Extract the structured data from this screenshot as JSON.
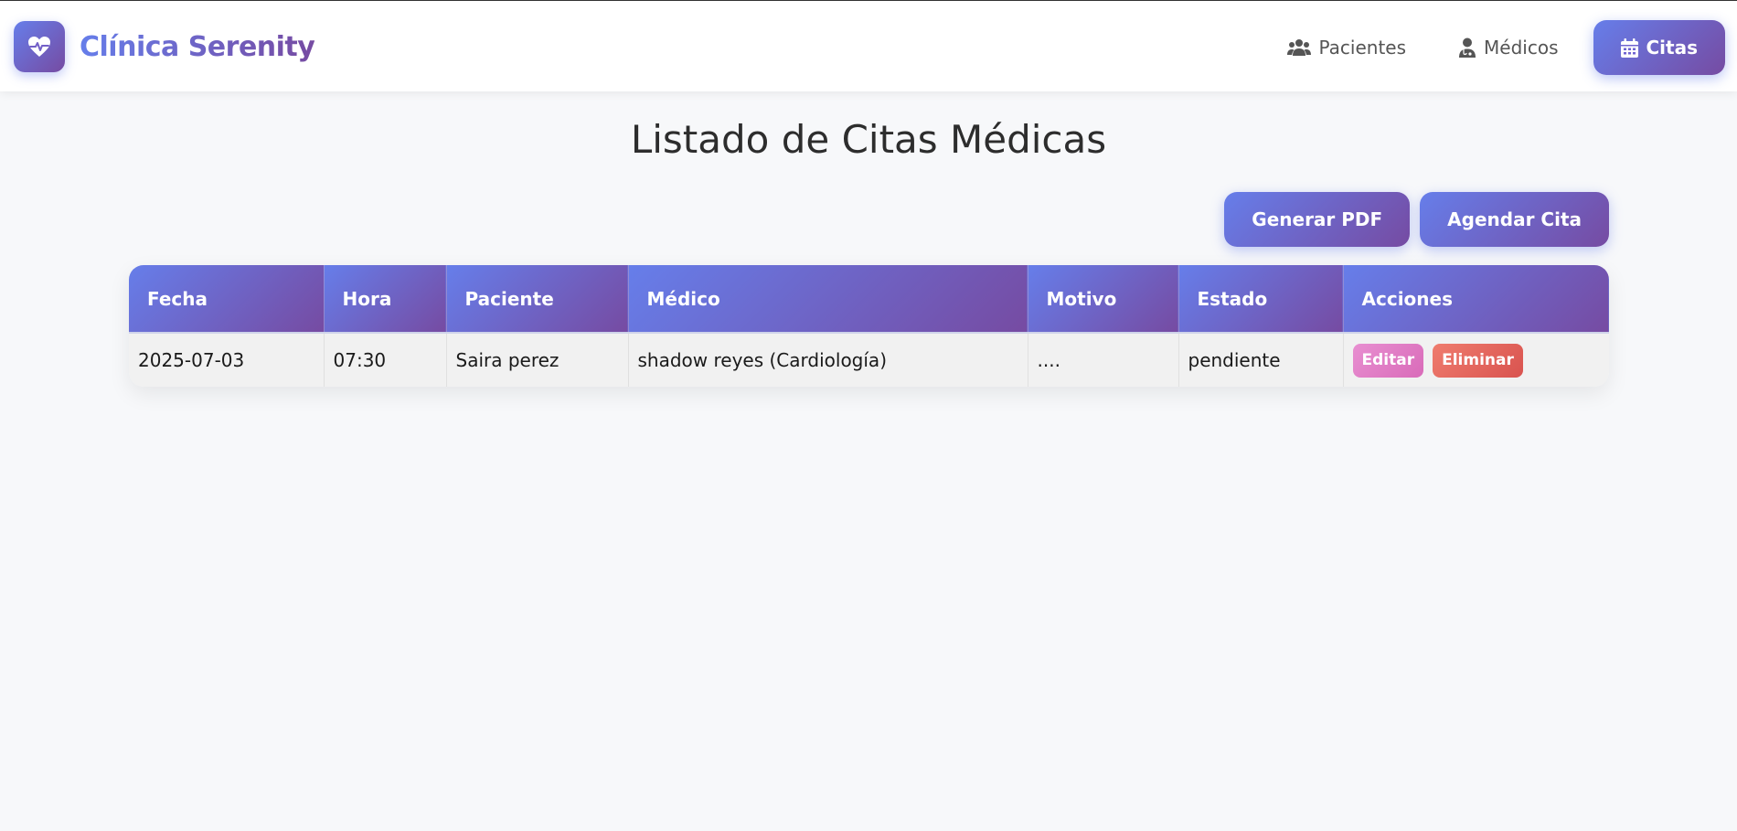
{
  "brand": {
    "name": "Clínica Serenity",
    "logo_icon": "heart-pulse-icon"
  },
  "nav": {
    "items": [
      {
        "label": "Pacientes",
        "icon": "users-icon",
        "active": false
      },
      {
        "label": "Médicos",
        "icon": "doctor-icon",
        "active": false
      },
      {
        "label": "Citas",
        "icon": "calendar-icon",
        "active": true
      }
    ]
  },
  "page": {
    "title": "Listado de Citas Médicas"
  },
  "actions": {
    "pdf_label": "Generar PDF",
    "schedule_label": "Agendar Cita"
  },
  "table": {
    "headers": [
      "Fecha",
      "Hora",
      "Paciente",
      "Médico",
      "Motivo",
      "Estado",
      "Acciones"
    ],
    "rows": [
      {
        "fecha": "2025-07-03",
        "hora": "07:30",
        "paciente": "Saira perez",
        "medico": "shadow reyes (Cardiología)",
        "motivo": "....",
        "estado": "pendiente",
        "edit_label": "Editar",
        "delete_label": "Eliminar"
      }
    ]
  },
  "colors": {
    "accent_start": "#667eea",
    "accent_end": "#764ba2",
    "edit": "#d96bb9",
    "delete": "#d9534f",
    "background": "#f7f8fa"
  }
}
